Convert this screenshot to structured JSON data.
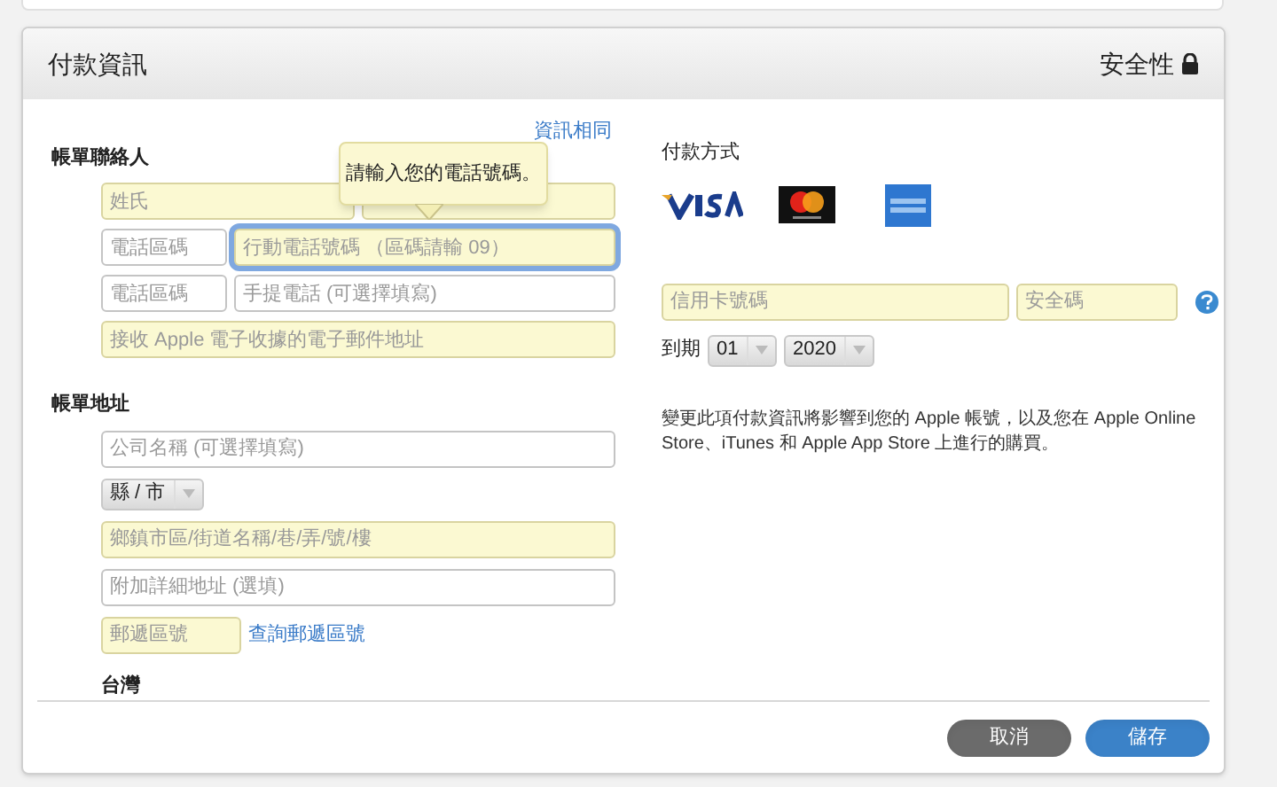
{
  "panel": {
    "title": "付款資訊",
    "security_label": "安全性"
  },
  "billing_contact": {
    "heading": "帳單聯絡人",
    "same_as_shipping_link": "資訊相同",
    "rows": [
      [
        {
          "kind": "wide",
          "placeholder": "姓氏",
          "required": true,
          "focused": false
        },
        {
          "kind": "wide",
          "required": true,
          "focused": false
        }
      ],
      [
        {
          "kind": "narrow",
          "placeholder": "電話區碼",
          "required": false,
          "focused": false
        },
        {
          "kind": "wide",
          "placeholder": "行動電話號碼 （區碼請輸 09）",
          "required": true,
          "focused": true
        }
      ],
      [
        {
          "kind": "narrow",
          "placeholder": "電話區碼",
          "required": false,
          "focused": false
        },
        {
          "kind": "wide",
          "placeholder": "手提電話 (可選擇填寫)",
          "required": false,
          "focused": false
        }
      ],
      [
        {
          "kind": "wide",
          "placeholder": "接收 Apple 電子收據的電子郵件地址",
          "required": true,
          "focused": false
        }
      ]
    ]
  },
  "tooltip": {
    "text": "請輸入您的電話號碼。"
  },
  "billing_address": {
    "heading": "帳單地址",
    "company": {
      "placeholder": "公司名稱 (可選擇填寫)",
      "required": false
    },
    "county_select": {
      "value": "縣 / 市"
    },
    "street": {
      "placeholder": "鄉鎮市區/街道名稱/巷/弄/號/樓",
      "required": true
    },
    "extra": {
      "placeholder": "附加詳細地址 (選填)",
      "required": false
    },
    "zip": {
      "placeholder": "郵遞區號",
      "required": true
    },
    "zip_lookup_link": "查詢郵遞區號",
    "country": "台灣"
  },
  "payment": {
    "heading": "付款方式",
    "card_number": {
      "placeholder": "信用卡號碼",
      "required": true
    },
    "security_code": {
      "placeholder": "安全碼",
      "required": true
    },
    "expiry_label": "到期",
    "month": "01",
    "year": "2020",
    "notice": "變更此項付款資訊將影響到您的 Apple 帳號，以及您在 Apple Online Store、iTunes 和 Apple App Store 上進行的購買。"
  },
  "buttons": [
    {
      "label": "取消",
      "kind": "secondary"
    },
    {
      "label": "儲存",
      "kind": "primary"
    }
  ]
}
